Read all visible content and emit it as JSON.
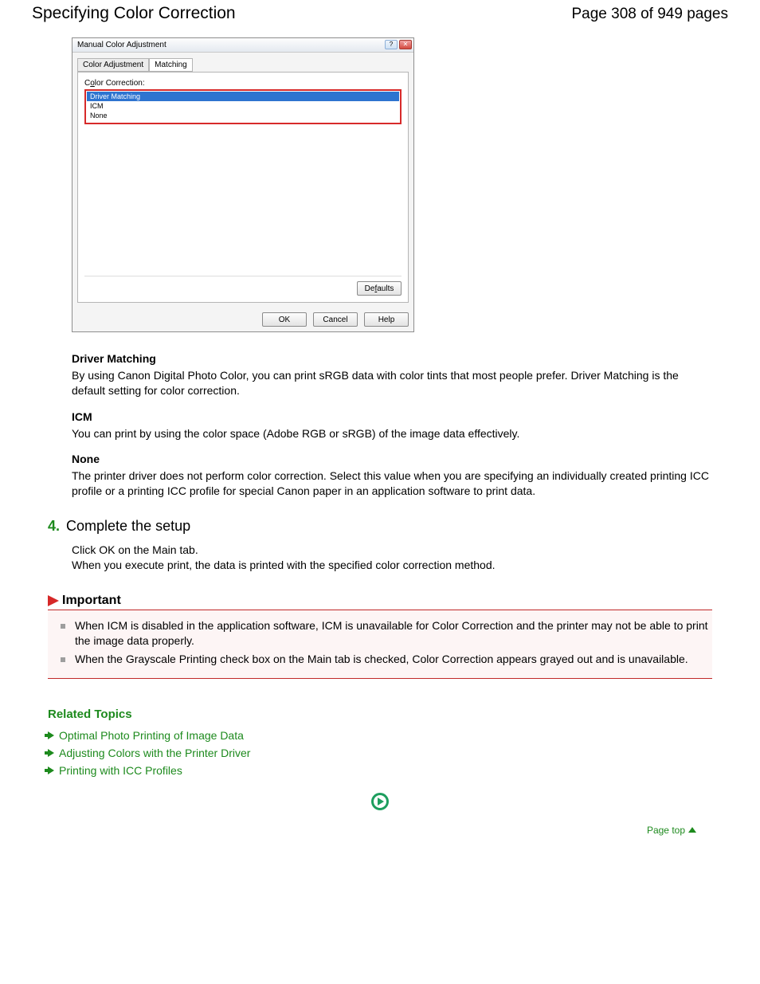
{
  "header": {
    "title": "Specifying Color Correction",
    "page_counter": "Page 308 of 949 pages"
  },
  "dialog": {
    "title": "Manual Color Adjustment",
    "tabs": {
      "inactive": "Color Adjustment",
      "active": "Matching"
    },
    "section_label_pre": "C",
    "section_label_u": "o",
    "section_label_post": "lor Correction:",
    "options": {
      "selected": "Driver Matching",
      "o2": "ICM",
      "o3": "None"
    },
    "buttons": {
      "defaults_pre": "De",
      "defaults_u": "f",
      "defaults_post": "aults",
      "ok": "OK",
      "cancel": "Cancel",
      "help": "Help"
    }
  },
  "defs": {
    "dm_title": "Driver Matching",
    "dm_body": "By using Canon Digital Photo Color, you can print sRGB data with color tints that most people prefer. Driver Matching is the default setting for color correction.",
    "icm_title": "ICM",
    "icm_body": "You can print by using the color space (Adobe RGB or sRGB) of the image data effectively.",
    "none_title": "None",
    "none_body": "The printer driver does not perform color correction. Select this value when you are specifying an individually created printing ICC profile or a printing ICC profile for special Canon paper in an application software to print data."
  },
  "step": {
    "num": "4.",
    "title": "Complete the setup",
    "line1": "Click OK on the Main tab.",
    "line2": "When you execute print, the data is printed with the specified color correction method."
  },
  "important": {
    "heading": "Important",
    "n1": "When ICM is disabled in the application software, ICM is unavailable for Color Correction and the printer may not be able to print the image data properly.",
    "n2": "When the Grayscale Printing check box on the Main tab is checked, Color Correction appears grayed out and is unavailable."
  },
  "related": {
    "title": "Related Topics",
    "l1": "Optimal Photo Printing of Image Data",
    "l2": "Adjusting Colors with the Printer Driver",
    "l3": "Printing with ICC Profiles"
  },
  "page_top": "Page top"
}
